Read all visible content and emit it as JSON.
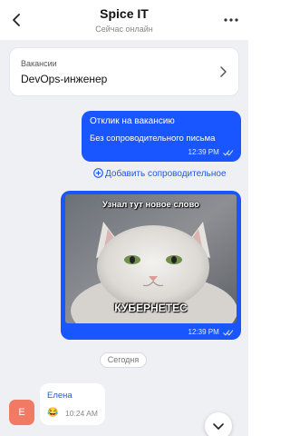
{
  "header": {
    "title": "Spice IT",
    "status": "Сейчас онлайн",
    "back_icon": "chevron-left-icon",
    "more_icon": "more-dots-icon"
  },
  "vacancy": {
    "label": "Вакансии",
    "value": "DevOps-инженер"
  },
  "messages": {
    "application": {
      "title": "Отклик на вакансию",
      "text": "Без сопроводительного письма",
      "time": "12:39 PM"
    },
    "add_cover_letter": "Добавить сопроводительное",
    "meme": {
      "top_text": "Узнал тут новое слово",
      "bottom_text": "КУБЕРНЕТЕС",
      "time": "12:39 PM"
    },
    "date_separator": "Сегодня",
    "incoming": {
      "avatar_letter": "E",
      "sender": "Елена",
      "emoji": "😂",
      "time": "10:24 AM"
    }
  },
  "colors": {
    "accent": "#1a56ff",
    "chat_bg": "#eef0f4",
    "avatar": "#f07a63"
  }
}
